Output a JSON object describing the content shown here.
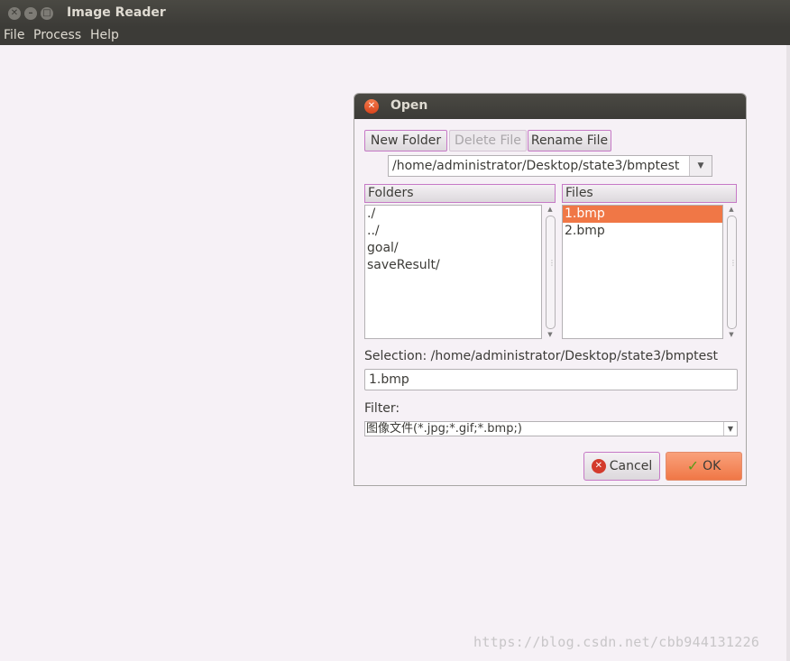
{
  "window": {
    "title": "Image Reader",
    "controls": [
      "close-icon",
      "minimize-icon",
      "maximize-icon"
    ]
  },
  "menubar": {
    "items": [
      {
        "label": "File"
      },
      {
        "label": "Process"
      },
      {
        "label": "Help"
      }
    ]
  },
  "dialog": {
    "title": "Open",
    "toolbar": {
      "new_folder": "New Folder",
      "delete_file": "Delete File",
      "rename_file": "Rename File"
    },
    "path": "/home/administrator/Desktop/state3/bmptest",
    "folders": {
      "header": "Folders",
      "items": [
        "./",
        "../",
        "goal/",
        "saveResult/"
      ]
    },
    "files": {
      "header": "Files",
      "items": [
        "1.bmp",
        "2.bmp"
      ],
      "selected": "1.bmp"
    },
    "selection_label": "Selection: /home/administrator/Desktop/state3/bmptest",
    "selection_value": "1.bmp",
    "filter_label": "Filter:",
    "filter_value": "图像文件(*.jpg;*.gif;*.bmp;)",
    "cancel_label": "Cancel",
    "ok_label": "OK"
  },
  "watermark": "https://blog.csdn.net/cbb944131226",
  "colors": {
    "titlebar": "#3c3b37",
    "accent": "#f07746",
    "background": "#f6f1f6",
    "button_border": "#c679c6"
  }
}
